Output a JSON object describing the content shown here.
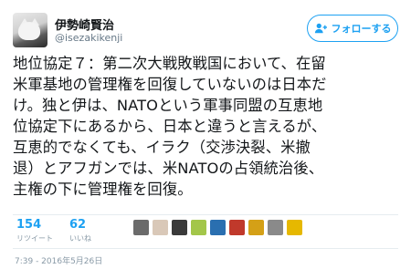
{
  "user": {
    "name": "伊勢崎賢治",
    "handle": "@isezakikenji"
  },
  "follow_button": {
    "label": "フォローする"
  },
  "tweet": {
    "text": "地位協定７：第二次大戦敗戦国において、在留\n米軍基地の管理権を回復していないのは日本だ\nけ。独と伊は、NATOという軍事同盟の互恵地\n位協定下にあるから、日本と違うと言えるが、\n互恵的でなくても、イラク（交渉決裂、米撤\n退）とアフガンでは、米NATOの占領統治後、\n主権の下に管理権を回復。"
  },
  "stats": {
    "retweets": {
      "count": "154",
      "label": "リツイート"
    },
    "likes": {
      "count": "62",
      "label": "いいね"
    }
  },
  "likers": [
    {
      "name": "liker-1",
      "color": "#6b6b6b"
    },
    {
      "name": "liker-2",
      "color": "#d9c8b8"
    },
    {
      "name": "liker-3",
      "color": "#3a3a3a"
    },
    {
      "name": "liker-4",
      "color": "#a3c64a"
    },
    {
      "name": "liker-5",
      "color": "#2a6fb0"
    },
    {
      "name": "liker-6",
      "color": "#c0392b"
    },
    {
      "name": "liker-7",
      "color": "#d4a017"
    },
    {
      "name": "liker-8",
      "color": "#8a8a8a"
    },
    {
      "name": "liker-9",
      "color": "#e6b800"
    }
  ],
  "timestamp": "7:39 - 2016年5月26日",
  "colors": {
    "accent": "#1da1f2",
    "muted": "#657786",
    "text": "#14171a"
  }
}
